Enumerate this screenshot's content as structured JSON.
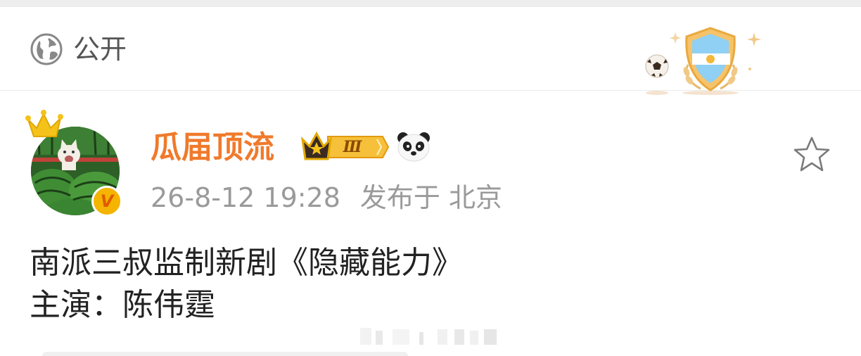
{
  "visibility": {
    "label": "公开",
    "icon": "globe-icon"
  },
  "decoration": {
    "icon": "argentina-shield-badge",
    "ball_icon": "soccer-ball-icon"
  },
  "post": {
    "author": {
      "name": "瓜届顶流",
      "level_badge": "Ⅲ",
      "crown_icon": "crown-icon",
      "verified_icon": "verified-v-icon",
      "emoji_icon": "panda-icon"
    },
    "timestamp": "26-8-12 19:28",
    "location": "发布于 北京",
    "favorite_icon": "star-outline-icon",
    "lines": [
      "南派三叔监制新剧《隐藏能力》",
      "主演：陈伟霆"
    ]
  },
  "colors": {
    "username": "#f07a2c",
    "meta": "#9a9a9a",
    "body": "#222222",
    "crown_gold": "#f4b400"
  }
}
